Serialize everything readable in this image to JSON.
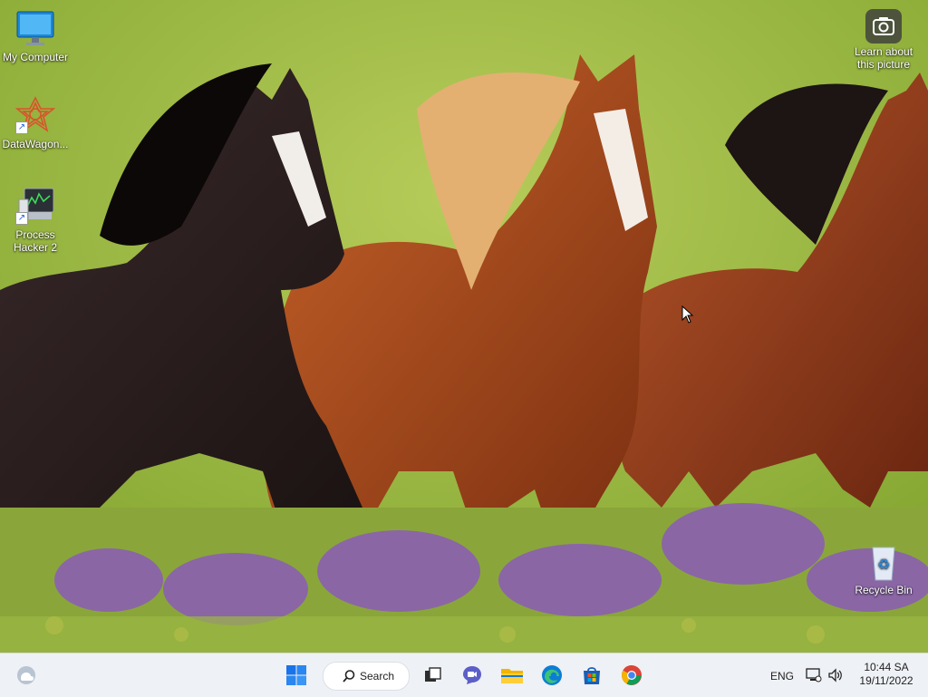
{
  "desktop": {
    "icons": [
      {
        "label": "My Computer"
      },
      {
        "label": "DataWagon..."
      },
      {
        "label": "Process Hacker 2"
      },
      {
        "label": "Recycle Bin"
      }
    ],
    "spotlight": {
      "label": "Learn about this picture"
    }
  },
  "taskbar": {
    "search_label": "Search",
    "apps": [
      "start",
      "search",
      "task-view",
      "teams-chat",
      "file-explorer",
      "edge",
      "store",
      "chrome"
    ]
  },
  "tray": {
    "language": "ENG",
    "time": "10:44 SA",
    "date": "19/11/2022"
  },
  "colors": {
    "taskbar_bg": "#eef1f5",
    "start_blue": "#1a73e8"
  }
}
